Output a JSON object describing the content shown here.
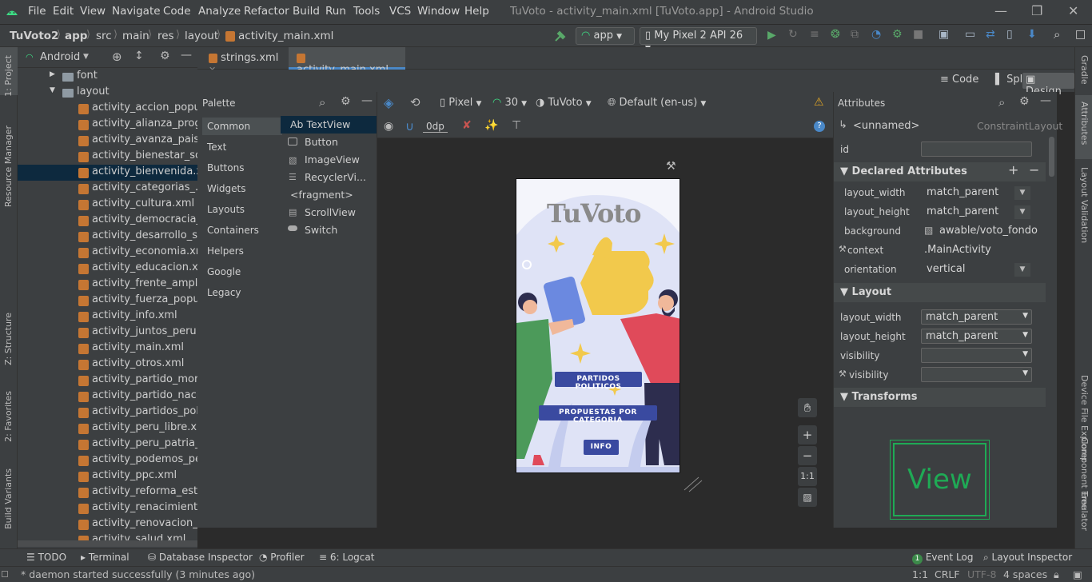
{
  "menubar": {
    "items": [
      "File",
      "Edit",
      "View",
      "Navigate",
      "Code",
      "Analyze",
      "Refactor",
      "Build",
      "Run",
      "Tools",
      "VCS",
      "Window",
      "Help"
    ],
    "window_title": "TuVoto - activity_main.xml [TuVoto.app] - Android Studio"
  },
  "breadcrumb": [
    "TuVoto2",
    "app",
    "src",
    "main",
    "res",
    "layout",
    "activity_main.xml"
  ],
  "toolbar": {
    "run_config": "app",
    "device": "My Pixel 2 API 26"
  },
  "left_stripe": [
    "1: Project",
    "Resource Manager",
    "Z: Structure",
    "2: Favorites",
    "Build Variants"
  ],
  "right_stripe": [
    "Gradle",
    "Attributes",
    "Layout Validation",
    "Component Tree",
    "Device File Explorer",
    "Emulator"
  ],
  "project": {
    "view_label": "Android",
    "folders": [
      "font",
      "layout"
    ],
    "files": [
      "activity_accion_popular",
      "activity_alianza_progres",
      "activity_avanza_pais.xml",
      "activity_bienestar_socia",
      "activity_bienvenida.xml",
      "activity_categorias_.xml",
      "activity_cultura.xml",
      "activity_democracia_dir",
      "activity_desarrollo_sost",
      "activity_economia.xml",
      "activity_educacion.xml",
      "activity_frente_amplio.x",
      "activity_fuerza_popular",
      "activity_info.xml",
      "activity_juntos_peru.xm",
      "activity_main.xml",
      "activity_otros.xml",
      "activity_partido_morad",
      "activity_partido_nacion",
      "activity_partidos_politic",
      "activity_peru_libre.xml",
      "activity_peru_patria_seg",
      "activity_podemos_peru",
      "activity_ppc.xml",
      "activity_reforma_estado",
      "activity_renacimiento_u",
      "activity_renovacion_pop",
      "activity_salud.xml"
    ]
  },
  "editor_tabs": [
    "strings.xml",
    "activity_main.xml"
  ],
  "modes": [
    "Code",
    "Split",
    "Design"
  ],
  "palette": {
    "title": "Palette",
    "categories": [
      "Common",
      "Text",
      "Buttons",
      "Widgets",
      "Layouts",
      "Containers",
      "Helpers",
      "Google",
      "Legacy"
    ],
    "items": [
      "Ab TextView",
      "Button",
      "ImageView",
      "RecyclerVi...",
      "<fragment>",
      "ScrollView",
      "Switch"
    ]
  },
  "design_toolbar": {
    "device": "Pixel",
    "api": "30",
    "theme": "TuVoto",
    "locale": "Default (en-us)",
    "margin": "0dp"
  },
  "app_preview": {
    "logo": "TuVoto",
    "buttons": [
      "PARTIDOS POLITICOS",
      "PROPUESTAS POR CATEGORIA",
      "INFO"
    ]
  },
  "zoom": {
    "ratio": "1:1"
  },
  "attributes": {
    "title": "Attributes",
    "component": "<unnamed>",
    "component_type": "ConstraintLayout",
    "id_label": "id",
    "sections": [
      "Declared Attributes",
      "Layout",
      "Transforms"
    ],
    "declared": [
      {
        "name": "layout_width",
        "value": "match_parent"
      },
      {
        "name": "layout_height",
        "value": "match_parent"
      },
      {
        "name": "background",
        "value": "awable/voto_fondo"
      },
      {
        "name": "context",
        "value": ".MainActivity"
      },
      {
        "name": "orientation",
        "value": "vertical"
      }
    ],
    "layout": [
      {
        "name": "layout_width",
        "value": "match_parent"
      },
      {
        "name": "layout_height",
        "value": "match_parent"
      },
      {
        "name": "visibility",
        "value": ""
      },
      {
        "name": "visibility",
        "value": ""
      }
    ],
    "view_preview": "View"
  },
  "bottom_tools": [
    "TODO",
    "Terminal",
    "Database Inspector",
    "Profiler",
    "6: Logcat",
    "Event Log",
    "Layout Inspector"
  ],
  "status": {
    "message": "* daemon started successfully (3 minutes ago)",
    "position": "1:1",
    "line_sep": "CRLF",
    "encoding": "UTF-8",
    "indent": "4 spaces"
  }
}
